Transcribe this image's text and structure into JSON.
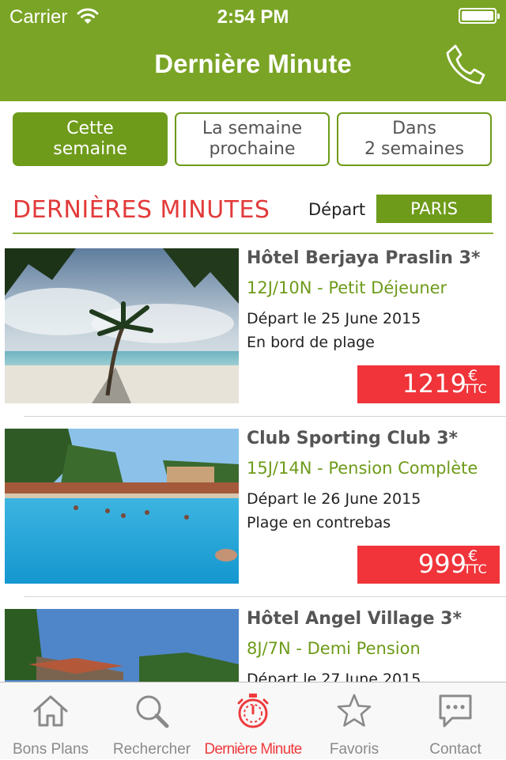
{
  "status_bar": {
    "carrier": "Carrier",
    "time": "2:54 PM"
  },
  "header": {
    "title": "Dernière Minute",
    "phone_icon": "phone-icon"
  },
  "week_tabs": [
    {
      "line1": "Cette",
      "line2": "semaine",
      "selected": true
    },
    {
      "line1": "La semaine",
      "line2": "prochaine",
      "selected": false
    },
    {
      "line1": "Dans",
      "line2": "2 semaines",
      "selected": false
    }
  ],
  "section": {
    "title": "DERNIÈRES MINUTES",
    "depart_label": "Départ",
    "city": "PARIS"
  },
  "offers": [
    {
      "name": "Hôtel Berjaya Praslin 3*",
      "board": "12J/10N - Petit Déjeuner",
      "date": "Départ le 25 June 2015",
      "location": "En bord de plage",
      "price": "1219",
      "currency": "€",
      "tax": "TTC"
    },
    {
      "name": "Club Sporting Club 3*",
      "board": "15J/14N - Pension Complète",
      "date": "Départ le 26 June 2015",
      "location": "Plage en contrebas",
      "price": "999",
      "currency": "€",
      "tax": "TTC"
    },
    {
      "name": "Hôtel Angel Village 3*",
      "board": "8J/7N - Demi Pension",
      "date": "Départ le 27 June 2015",
      "location": "",
      "price": "",
      "currency": "",
      "tax": ""
    }
  ],
  "tab_bar": [
    {
      "label": "Bons Plans",
      "icon": "house-icon",
      "active": false
    },
    {
      "label": "Rechercher",
      "icon": "magnifier-icon",
      "active": false
    },
    {
      "label": "Dernière Minute",
      "icon": "stopwatch-icon",
      "active": true
    },
    {
      "label": "Favoris",
      "icon": "star-icon",
      "active": false
    },
    {
      "label": "Contact",
      "icon": "chat-bubble-icon",
      "active": false
    }
  ],
  "colors": {
    "brand_green": "#7aa425",
    "accent_red": "#f0343a",
    "title_red": "#e23a3a",
    "inactive_gray": "#8a8a8a"
  }
}
